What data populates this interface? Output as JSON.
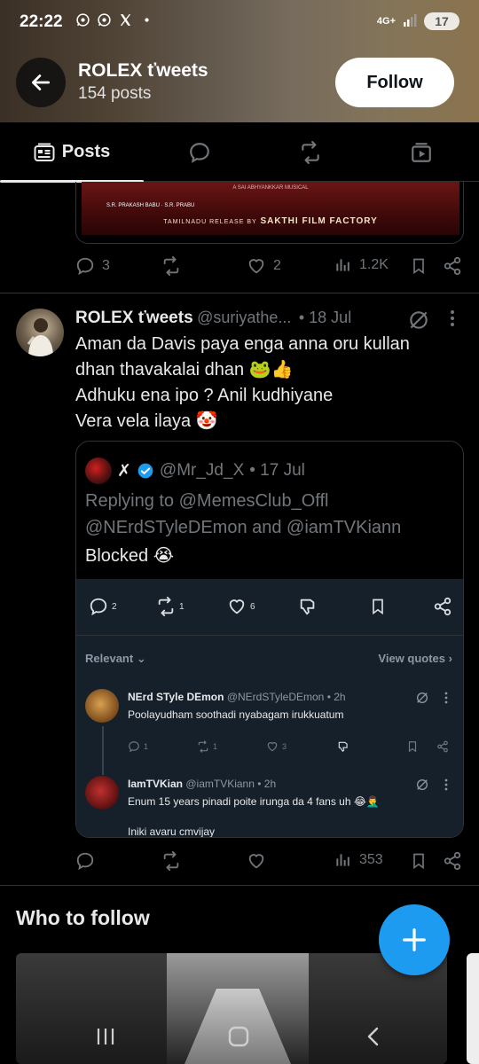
{
  "status_bar": {
    "time": "22:22",
    "network": "4G+",
    "battery": "17",
    "app_icons": [
      "whatsapp-icon",
      "whatsapp-icon",
      "x-icon",
      "dot"
    ]
  },
  "header": {
    "title": "ROLEX ťweets",
    "post_count": "154 posts",
    "follow_label": "Follow"
  },
  "tabs": [
    {
      "label": "Posts",
      "icon": "posts-icon",
      "active": true
    },
    {
      "label": "",
      "icon": "reply-bubble-icon"
    },
    {
      "label": "",
      "icon": "repost-icon"
    },
    {
      "label": "",
      "icon": "media-icon"
    }
  ],
  "prev_post": {
    "poster": {
      "composer": "A SAI ABHYANKKAR MUSICAL",
      "release": "TAMILNADU RELEASE BY",
      "distributor": "SAKTHI FILM FACTORY",
      "producers": "S.R. PRAKASH BABU · S.R. PRABU"
    },
    "replies": "3",
    "reposts": "",
    "likes": "2",
    "views": "1.2K"
  },
  "post": {
    "name": "ROLEX ťweets",
    "handle": "@suriyathe...",
    "date": "• 18 Jul",
    "lines": [
      "Aman da Davis paya enga anna oru kullan",
      "dhan thavakalai dhan 🐸👍",
      "Adhuku ena ipo ? Anil kudhiyane",
      "Vera vela ilaya 🤡"
    ],
    "views": "353"
  },
  "quote": {
    "name": "✗",
    "handle": "@Mr_Jd_X",
    "date": "• 17 Jul",
    "reply_line1": "Replying to @MemesClub_Offl",
    "reply_line2": "@NErdSTyleDEmon and @iamTVKiann",
    "text": "Blocked 😭",
    "replies": "2",
    "reposts": "1",
    "likes": "6",
    "sort_label": "Relevant",
    "view_quotes": "View quotes",
    "replies_list": [
      {
        "name": "NErd STyle DEmon",
        "handle": "@NErdSTyleDEmon • 2h",
        "text": "Poolayudham soothadi nyabagam irukkuatum",
        "replies": "1",
        "reposts": "1",
        "likes": "3"
      },
      {
        "name": "IamTVKian",
        "handle": "@iamTVKiann • 2h",
        "text": "Enum 15 years pinadi poite irunga da 4 fans uh 😂🤦‍♂️",
        "text2": "Iniki avaru cmvijay"
      }
    ]
  },
  "who_to_follow": "Who to follow",
  "colors": {
    "accent": "#1d9bf0",
    "background": "#000000",
    "muted": "#71767b"
  }
}
